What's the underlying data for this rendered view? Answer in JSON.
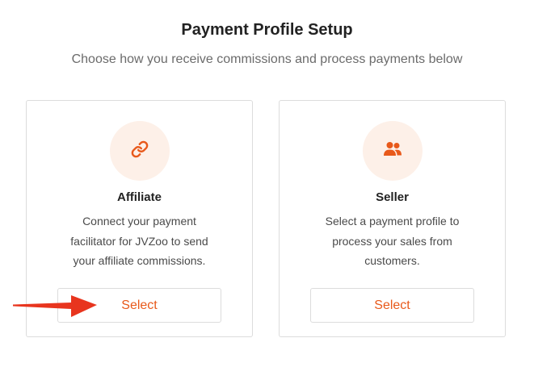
{
  "header": {
    "title": "Payment Profile Setup",
    "subtitle": "Choose how you receive commissions and process payments below"
  },
  "cards": [
    {
      "title": "Affiliate",
      "description": "Connect your payment facilitator for JVZoo to send your affiliate commissions.",
      "button_label": "Select",
      "icon": "link-icon"
    },
    {
      "title": "Seller",
      "description": "Select a payment profile to process your sales from customers.",
      "button_label": "Select",
      "icon": "users-icon"
    }
  ],
  "annotation": {
    "icon": "red-arrow-icon",
    "color": "#e8351e"
  },
  "colors": {
    "accent": "#e8591a",
    "icon_bg": "#fdf0e8"
  }
}
